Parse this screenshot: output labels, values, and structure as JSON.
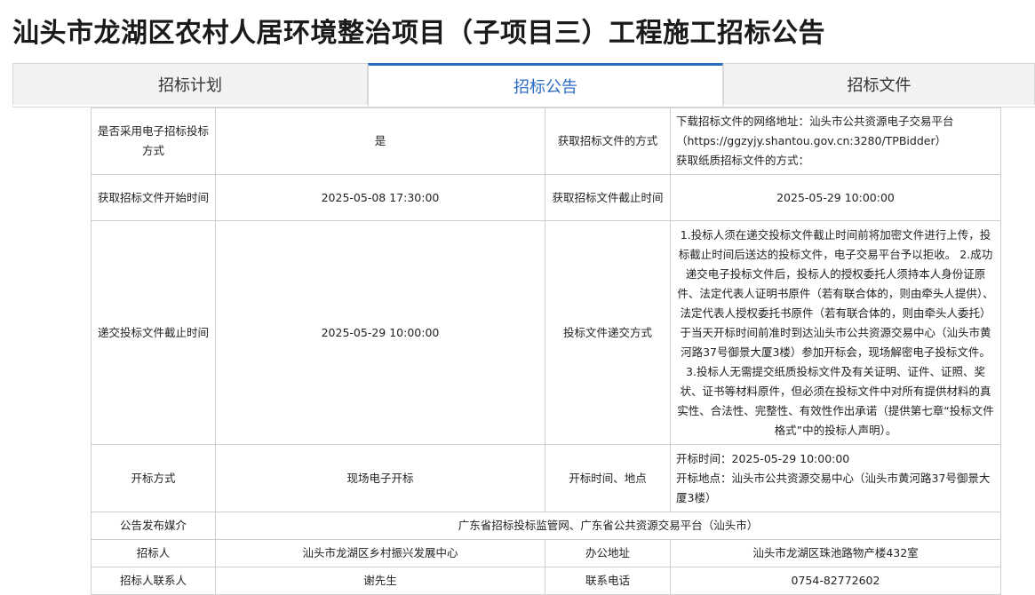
{
  "page_title": "汕头市龙湖区农村人居环境整治项目（子项目三）工程施工招标公告",
  "tabs": [
    {
      "label": "招标计划",
      "active": false
    },
    {
      "label": "招标公告",
      "active": true
    },
    {
      "label": "招标文件",
      "active": false
    }
  ],
  "table": {
    "r1": {
      "l1": "是否采用电子招标投标方式",
      "v1": "是",
      "l2": "获取招标文件的方式",
      "v2_line1": "下载招标文件的网络地址：汕头市公共资源电子交易平台（https://ggzyjy.shantou.gov.cn:3280/TPBidder）",
      "v2_line2": "获取纸质招标文件的方式："
    },
    "r2": {
      "l1": "获取招标文件开始时间",
      "v1": "2025-05-08 17:30:00",
      "l2": "获取招标文件截止时间",
      "v2": "2025-05-29 10:00:00"
    },
    "r3": {
      "l1": "递交投标文件截止时间",
      "v1": "2025-05-29 10:00:00",
      "l2": "投标文件递交方式",
      "v2": "1.投标人须在递交投标文件截止时间前将加密文件进行上传，投标截止时间后送达的投标文件，电子交易平台予以拒收。 2.成功递交电子投标文件后，投标人的授权委托人须持本人身份证原件、法定代表人证明书原件（若有联合体的，则由牵头人提供）、法定代表人授权委托书原件（若有联合体的，则由牵头人委托）于当天开标时间前准时到达汕头市公共资源交易中心（汕头市黄河路37号御景大厦3楼）参加开标会，现场解密电子投标文件。 3.投标人无需提交纸质投标文件及有关证明、证件、证照、奖状、证书等材料原件，但必须在投标文件中对所有提供材料的真实性、合法性、完整性、有效性作出承诺（提供第七章“投标文件格式”中的投标人声明）。"
    },
    "r4": {
      "l1": "开标方式",
      "v1": "现场电子开标",
      "l2": "开标时间、地点",
      "v2_line1": "开标时间：2025-05-29 10:00:00",
      "v2_line2": "开标地点：汕头市公共资源交易中心（汕头市黄河路37号御景大厦3楼）"
    },
    "r5": {
      "l1": "公告发布媒介",
      "v1": "广东省招标投标监管网、广东省公共资源交易平台（汕头市）"
    },
    "r6": {
      "l1": "招标人",
      "v1": "汕头市龙湖区乡村振兴发展中心",
      "l2": "办公地址",
      "v2": "汕头市龙湖区珠池路物产楼432室"
    },
    "r7": {
      "l1": "招标人联系人",
      "v1": "谢先生",
      "l2": "联系电话",
      "v2": "0754-82772602"
    }
  }
}
